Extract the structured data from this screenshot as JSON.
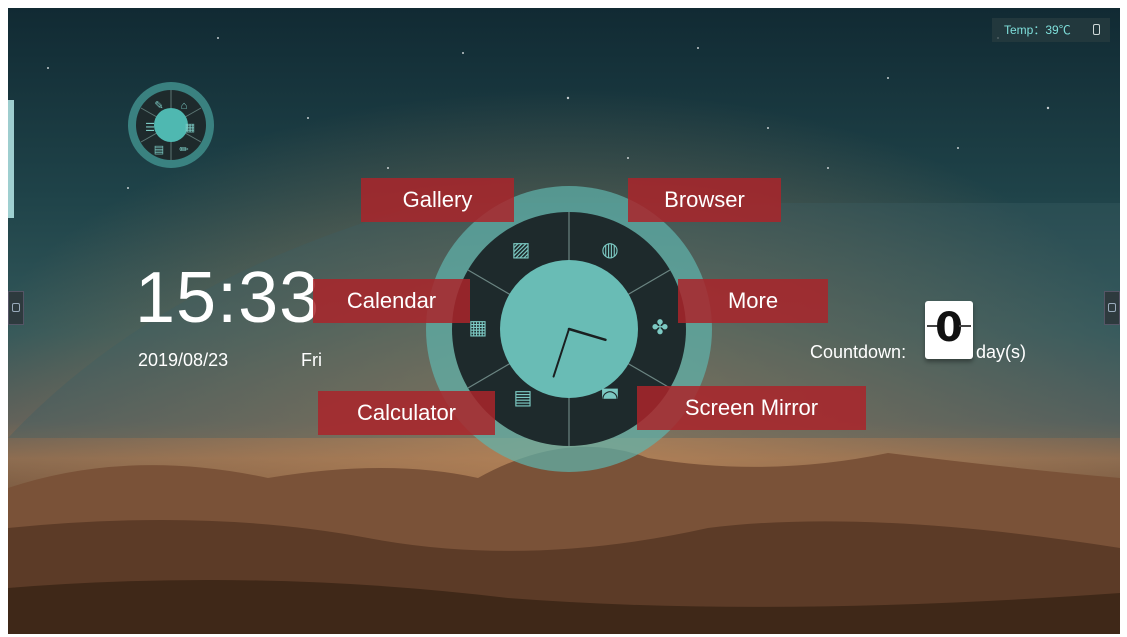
{
  "status_bar": {
    "temp_label": "Temp：39℃",
    "battery_icon": "battery-icon"
  },
  "clock": {
    "time": "15:33",
    "date": "2019/08/23",
    "weekday": "Fri"
  },
  "countdown": {
    "label": "Countdown:",
    "value": "0",
    "unit": "day(s)"
  },
  "wheel": {
    "items": [
      {
        "label": "Gallery",
        "icon": "gallery-icon"
      },
      {
        "label": "Browser",
        "icon": "globe-icon"
      },
      {
        "label": "Calendar",
        "icon": "calendar-icon"
      },
      {
        "label": "More",
        "icon": "more-icon"
      },
      {
        "label": "Calculator",
        "icon": "calculator-icon"
      },
      {
        "label": "Screen Mirror",
        "icon": "screen-mirror-icon"
      }
    ],
    "clock_hands": {
      "hour": 15,
      "minute": 33
    }
  },
  "colors": {
    "accent": "#7fe0dc",
    "tag_bg": "#aa242a",
    "ring": "#5fb5ae",
    "dark_ring": "#1e2a2c"
  }
}
